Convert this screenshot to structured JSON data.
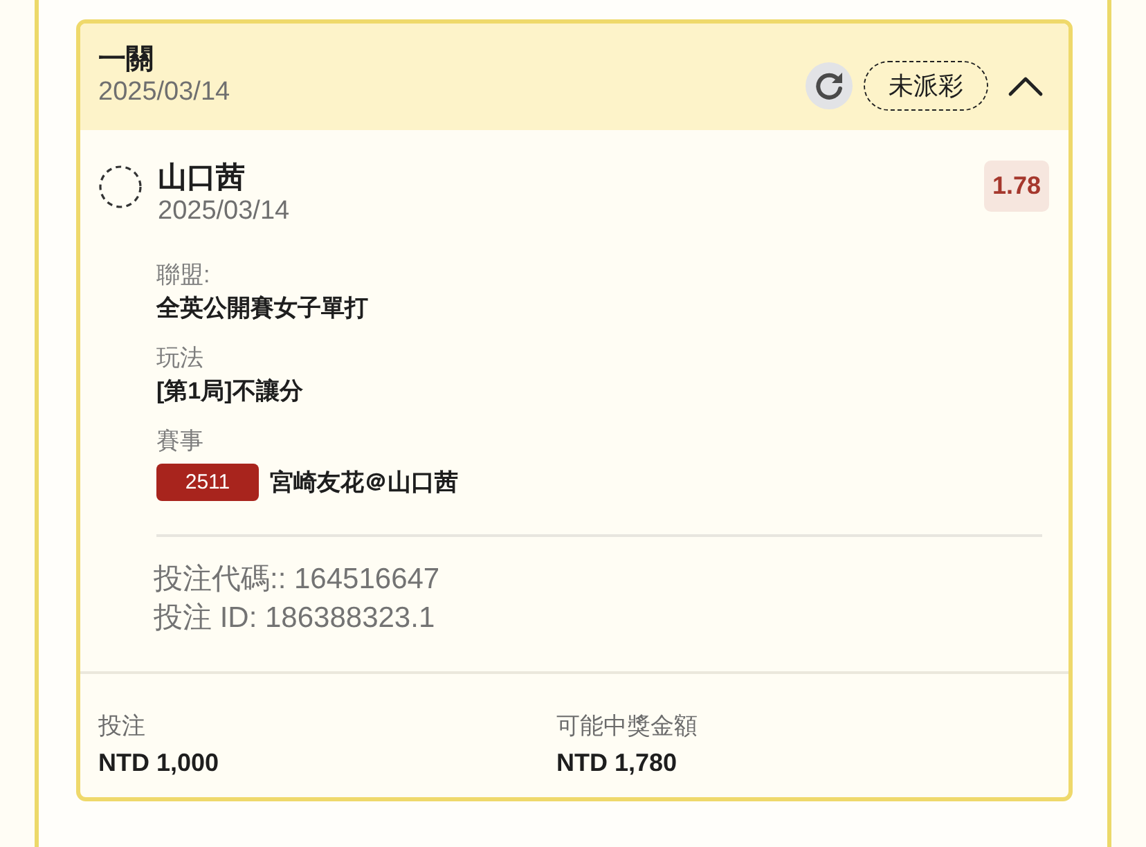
{
  "bet": {
    "title": "一關",
    "date": "2025/03/14",
    "status": "未派彩",
    "expanded": true
  },
  "selection": {
    "name": "山口茜",
    "date": "2025/03/14",
    "odds": "1.78",
    "fields": [
      {
        "label": "聯盟:",
        "value": "全英公開賽女子單打"
      },
      {
        "label": "玩法",
        "value": "[第1局]不讓分"
      }
    ],
    "event": {
      "label": "賽事",
      "code": "2511",
      "match": "宮崎友花＠山口茜"
    }
  },
  "references": [
    "投注代碼:: 164516647",
    "投注 ID: 186388323.1"
  ],
  "totals": [
    {
      "label": "投注",
      "value": "NTD 1,000"
    },
    {
      "label": "可能中獎金額",
      "value": "NTD 1,780"
    }
  ]
}
